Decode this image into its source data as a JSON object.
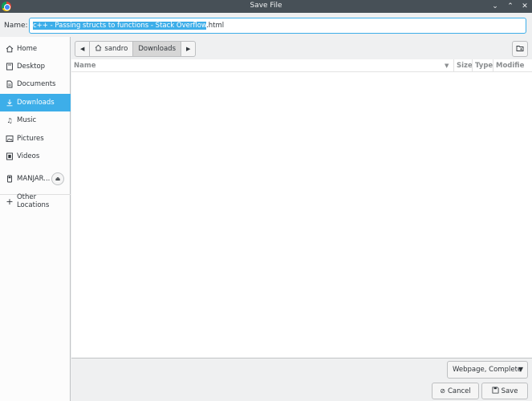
{
  "window": {
    "title": "Save File"
  },
  "name_field": {
    "label": "Name:",
    "value_selected": "c++ - Passing structs to functions - Stack Overflow",
    "value_rest": ".html"
  },
  "sidebar": {
    "items": [
      {
        "label": "Home",
        "icon": "home-icon"
      },
      {
        "label": "Desktop",
        "icon": "desktop-icon"
      },
      {
        "label": "Documents",
        "icon": "documents-icon"
      },
      {
        "label": "Downloads",
        "icon": "downloads-icon"
      },
      {
        "label": "Music",
        "icon": "music-icon"
      },
      {
        "label": "Pictures",
        "icon": "pictures-icon"
      },
      {
        "label": "Videos",
        "icon": "videos-icon"
      }
    ],
    "device": {
      "label": "MANJAR...",
      "icon": "drive-icon"
    },
    "other": {
      "label": "Other Locations",
      "icon": "plus-icon"
    }
  },
  "pathbar": {
    "home": "sandro",
    "current": "Downloads"
  },
  "columns": {
    "name": "Name",
    "size": "Size",
    "type": "Type",
    "modified": "Modifie"
  },
  "filter": {
    "selected": "Webpage, Complete"
  },
  "buttons": {
    "cancel": "Cancel",
    "save": "Save"
  },
  "colors": {
    "accent": "#3daee9",
    "titlebar": "#475057"
  }
}
